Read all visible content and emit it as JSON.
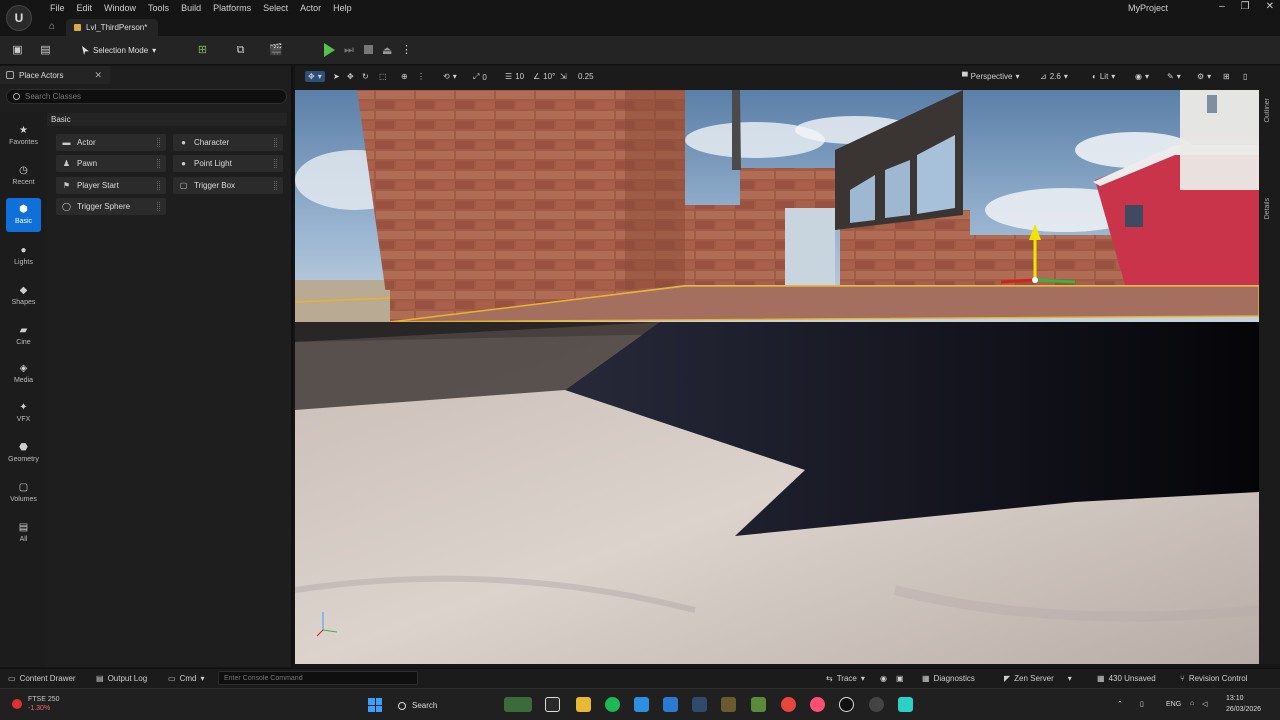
{
  "menu": [
    "File",
    "Edit",
    "Window",
    "Tools",
    "Build",
    "Platforms",
    "Select",
    "Actor",
    "Help"
  ],
  "project_name": "MyProject",
  "window_controls": {
    "minimize": "–",
    "restore": "❐",
    "close": "✕"
  },
  "level_tab": "Lvl_ThirdPerson*",
  "toolbar": {
    "selection_mode": "Selection Mode"
  },
  "place_actors": {
    "tab_title": "Place Actors",
    "search_placeholder": "Search Classes",
    "section_header": "Basic",
    "categories": [
      "Favorites",
      "Recent",
      "Basic",
      "Lights",
      "Shapes",
      "Cine",
      "Media",
      "VFX",
      "Geometry",
      "Volumes",
      "All"
    ],
    "active_category": "Basic",
    "actors": [
      {
        "label": "Actor",
        "icon": "actor-icon"
      },
      {
        "label": "Character",
        "icon": "character-icon"
      },
      {
        "label": "Pawn",
        "icon": "pawn-icon"
      },
      {
        "label": "Point Light",
        "icon": "point-light-icon"
      },
      {
        "label": "Player Start",
        "icon": "player-start-icon"
      },
      {
        "label": "Trigger Box",
        "icon": "trigger-box-icon"
      },
      {
        "label": "Trigger Sphere",
        "icon": "trigger-sphere-icon"
      }
    ]
  },
  "viewport": {
    "grid_snap": "10",
    "rotation_snap": "10°",
    "scale_snap": "0.25",
    "translate_value": "0",
    "view_mode_perspective": "Perspective",
    "camera_speed": "2.6",
    "lighting_mode": "Lit",
    "side_tabs": [
      "Outliner",
      "Details"
    ]
  },
  "statusbar": {
    "content_drawer": "Content Drawer",
    "output_log": "Output Log",
    "cmd": "Cmd",
    "console_placeholder": "Enter Console Command",
    "trace": "Trace",
    "diagnostics": "Diagnostics",
    "zen_server": "Zen Server",
    "unsaved": "430 Unsaved",
    "revision_control": "Revision Control"
  },
  "taskbar": {
    "stock_name": "FTSE 250",
    "stock_change": "-1.30%",
    "search_label": "Search",
    "language": "ENG",
    "time": "13:10",
    "date": "26/03/2026"
  },
  "colors": {
    "accent": "#0f70d9",
    "play_green": "#53c24a",
    "selection_outline": "#e8b430"
  }
}
